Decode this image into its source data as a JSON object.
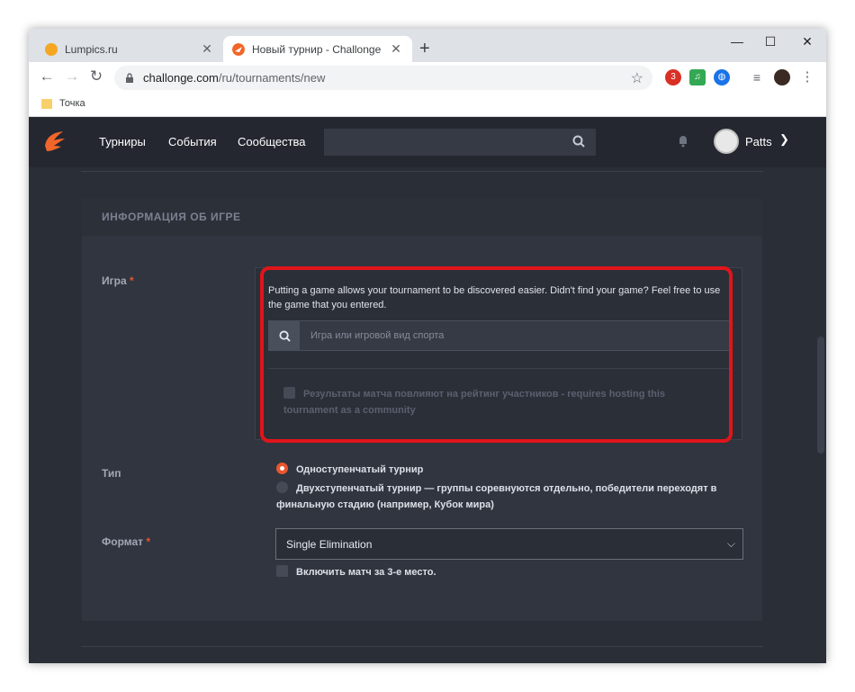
{
  "browser": {
    "tabs": [
      {
        "title": "Lumpics.ru",
        "active": false,
        "favicon_color": "#f5a623"
      },
      {
        "title": "Новый турнир - Challonge",
        "active": true,
        "favicon_color": "#f0662a"
      }
    ],
    "url_host": "challonge.com",
    "url_path": "/ru/tournaments/new",
    "extension_badge": "3",
    "bookmark": "Точка"
  },
  "site": {
    "nav": [
      "Турниры",
      "События",
      "Сообщества"
    ],
    "user": "Patts",
    "accent_color": "#e8552f"
  },
  "section": {
    "title": "ИНФОРМАЦИЯ ОБ ИГРЕ",
    "game_label": "Игра",
    "required_mark": "*",
    "game_help": "Putting a game allows your tournament to be discovered easier. Didn't find your game? Feel free to use the game that you entered.",
    "game_placeholder": "Игра или игровой вид спорта",
    "rating_checkbox": "Результаты матча повлияют на рейтинг участников - requires hosting this tournament as a community",
    "type_label": "Тип",
    "type_options": [
      {
        "label": "Одноступенчатый турнир",
        "selected": true
      },
      {
        "label": "Двухступенчатый турнир — группы соревнуются отдельно, победители переходят в финальную стадию (например, Кубок мира)",
        "selected": false
      }
    ],
    "format_label": "Формат",
    "format_value": "Single Elimination",
    "third_place": "Включить матч за 3-е место."
  }
}
